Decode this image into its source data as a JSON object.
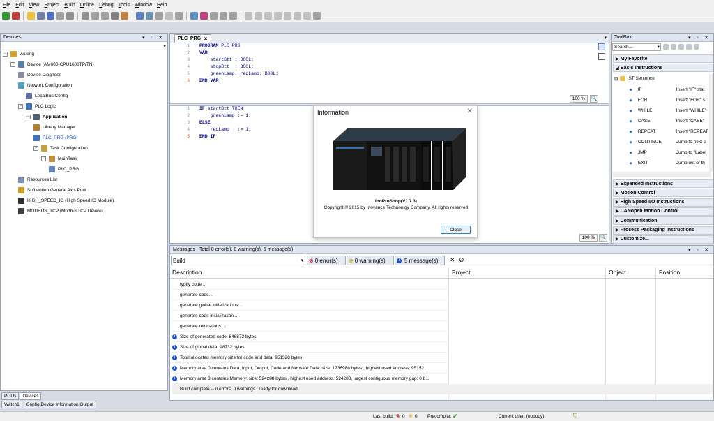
{
  "menu": [
    "File",
    "Edit",
    "View",
    "Project",
    "Build",
    "Online",
    "Debug",
    "Tools",
    "Window",
    "Help"
  ],
  "devices": {
    "title": "Devices",
    "tree": [
      {
        "label": "vvueng",
        "level": 0,
        "icon": "project-icon"
      },
      {
        "label": "Device (AM600-CPU1608TP/TN)",
        "level": 1,
        "icon": "plc-device-icon"
      },
      {
        "label": "Device Diagnose",
        "level": 2,
        "icon": "diagnose-icon"
      },
      {
        "label": "Network Configuration",
        "level": 2,
        "icon": "network-icon"
      },
      {
        "label": "LocalBus Config",
        "level": 3,
        "icon": "localbus-icon"
      },
      {
        "label": "PLC Logic",
        "level": 2,
        "icon": "plc-logic-icon"
      },
      {
        "label": "Application",
        "level": 3,
        "icon": "application-icon"
      },
      {
        "label": "Library Manager",
        "level": 4,
        "icon": "library-icon"
      },
      {
        "label": "PLC_PRG (PRG)",
        "level": 4,
        "icon": "program-icon"
      },
      {
        "label": "Task Configuration",
        "level": 4,
        "icon": "task-config-icon"
      },
      {
        "label": "MainTask",
        "level": 5,
        "icon": "task-icon"
      },
      {
        "label": "PLC_PRG",
        "level": 6,
        "icon": "program-call-icon"
      },
      {
        "label": "Resources List",
        "level": 2,
        "icon": "resources-icon"
      },
      {
        "label": "SoftMotion General Axis Pool",
        "level": 2,
        "icon": "axis-pool-icon"
      },
      {
        "label": "HIGH_SPEED_IO (High Speed IO Module)",
        "level": 2,
        "icon": "io-module-icon"
      },
      {
        "label": "MODBUS_TCP (ModbusTCP Device)",
        "level": 2,
        "icon": "modbus-icon"
      }
    ],
    "tabs": [
      "POUs",
      "Devices"
    ]
  },
  "bottom_tabs": [
    "Watch1",
    "Config Device Information Output"
  ],
  "editor": {
    "tab": "PLC_PRG",
    "zoom": "100 %",
    "decl_lines": [
      "1",
      "2",
      "3",
      "4",
      "5",
      "6"
    ],
    "decl_code": [
      {
        "kw": "PROGRAM",
        "rest": " PLC_PRG"
      },
      {
        "kw": "VAR",
        "rest": ""
      },
      {
        "kw": "",
        "rest": "    startBtt : BOOL;"
      },
      {
        "kw": "",
        "rest": "    stopBtt  : BOOL;"
      },
      {
        "kw": "",
        "rest": "    greenLamp, redLamp: BOOL;"
      },
      {
        "kw": "END_VAR",
        "rest": ""
      }
    ],
    "impl_lines": [
      "1",
      "2",
      "3",
      "4",
      "5"
    ],
    "impl_code": [
      {
        "kw": "IF",
        "rest": " startBtt THEN"
      },
      {
        "kw": "",
        "rest": "    greenLamp := 1;"
      },
      {
        "kw": "ELSE",
        "rest": ""
      },
      {
        "kw": "",
        "rest": "    redLamp   := 1;"
      },
      {
        "kw": "END_IF",
        "rest": ""
      }
    ]
  },
  "dialog": {
    "title": "Information",
    "product": "InoProShop(V1.7.3)",
    "copyright": "Copyright © 2015 by Inovance Technonlgy Company. All rights reserved",
    "close": "Close"
  },
  "toolbox": {
    "title": "ToolBox",
    "search_placeholder": "Search...",
    "sections_top": [
      "My Favorite",
      "Basic Instructions"
    ],
    "group": "ST Sentence",
    "items": [
      {
        "name": "IF",
        "desc": "Insert \"IF\" stat"
      },
      {
        "name": "FOR",
        "desc": "Insert \"FOR\" s"
      },
      {
        "name": "WHILE",
        "desc": "Insert \"WHILE\""
      },
      {
        "name": "CASE",
        "desc": "Insert \"CASE\""
      },
      {
        "name": "REPEAT",
        "desc": "Insert \"REPEAT"
      },
      {
        "name": "CONTINUE",
        "desc": "Jump to next c"
      },
      {
        "name": "JMP",
        "desc": "Jump to \"Label"
      },
      {
        "name": "EXIT",
        "desc": "Jump out of th"
      }
    ],
    "sections_bottom": [
      "Expanded Instructions",
      "Motion Control",
      "High Speed I/O Instructions",
      "CANopen Motion Control",
      "Communication",
      "Process Packaging Instructions",
      "Customize..."
    ]
  },
  "messages": {
    "title": "Messages - Total 0 error(s), 0 warning(s), 5 message(s)",
    "filter": "Build",
    "errors": "0 error(s)",
    "warnings": "0 warning(s)",
    "messages_count": "5 message(s)",
    "columns": [
      "Description",
      "Project",
      "Object",
      "Position"
    ],
    "rows": [
      {
        "text": "typify code ...",
        "info": false
      },
      {
        "text": "generate code...",
        "info": false
      },
      {
        "text": "generate global initializations ...",
        "info": false
      },
      {
        "text": "generate code initialization ...",
        "info": false
      },
      {
        "text": "generate relocations ...",
        "info": false
      },
      {
        "text": "Size of generated code: 646872 bytes",
        "info": true
      },
      {
        "text": "Size of global data: 98732 bytes",
        "info": true
      },
      {
        "text": "Total allocated memory size for code and data: 951528 bytes",
        "info": true
      },
      {
        "text": "Memory area 0 contains  Data, Input, Output, Code and Nonsafe Data: size: 1236986 bytes , highest used address: 95152...",
        "info": true
      },
      {
        "text": "Memory area 3 contains  Memory: size: 524288 bytes , highest used address: 524288, largest contiguous memory gap: 0 b...",
        "info": true
      },
      {
        "text": "Build complete -- 0 errors, 0 warnings : ready for download!",
        "info": false
      }
    ]
  },
  "status": {
    "last_build": "Last build:",
    "err": "0",
    "warn": "0",
    "precompile": "Precompile:",
    "user": "Current user: (nobody)"
  }
}
